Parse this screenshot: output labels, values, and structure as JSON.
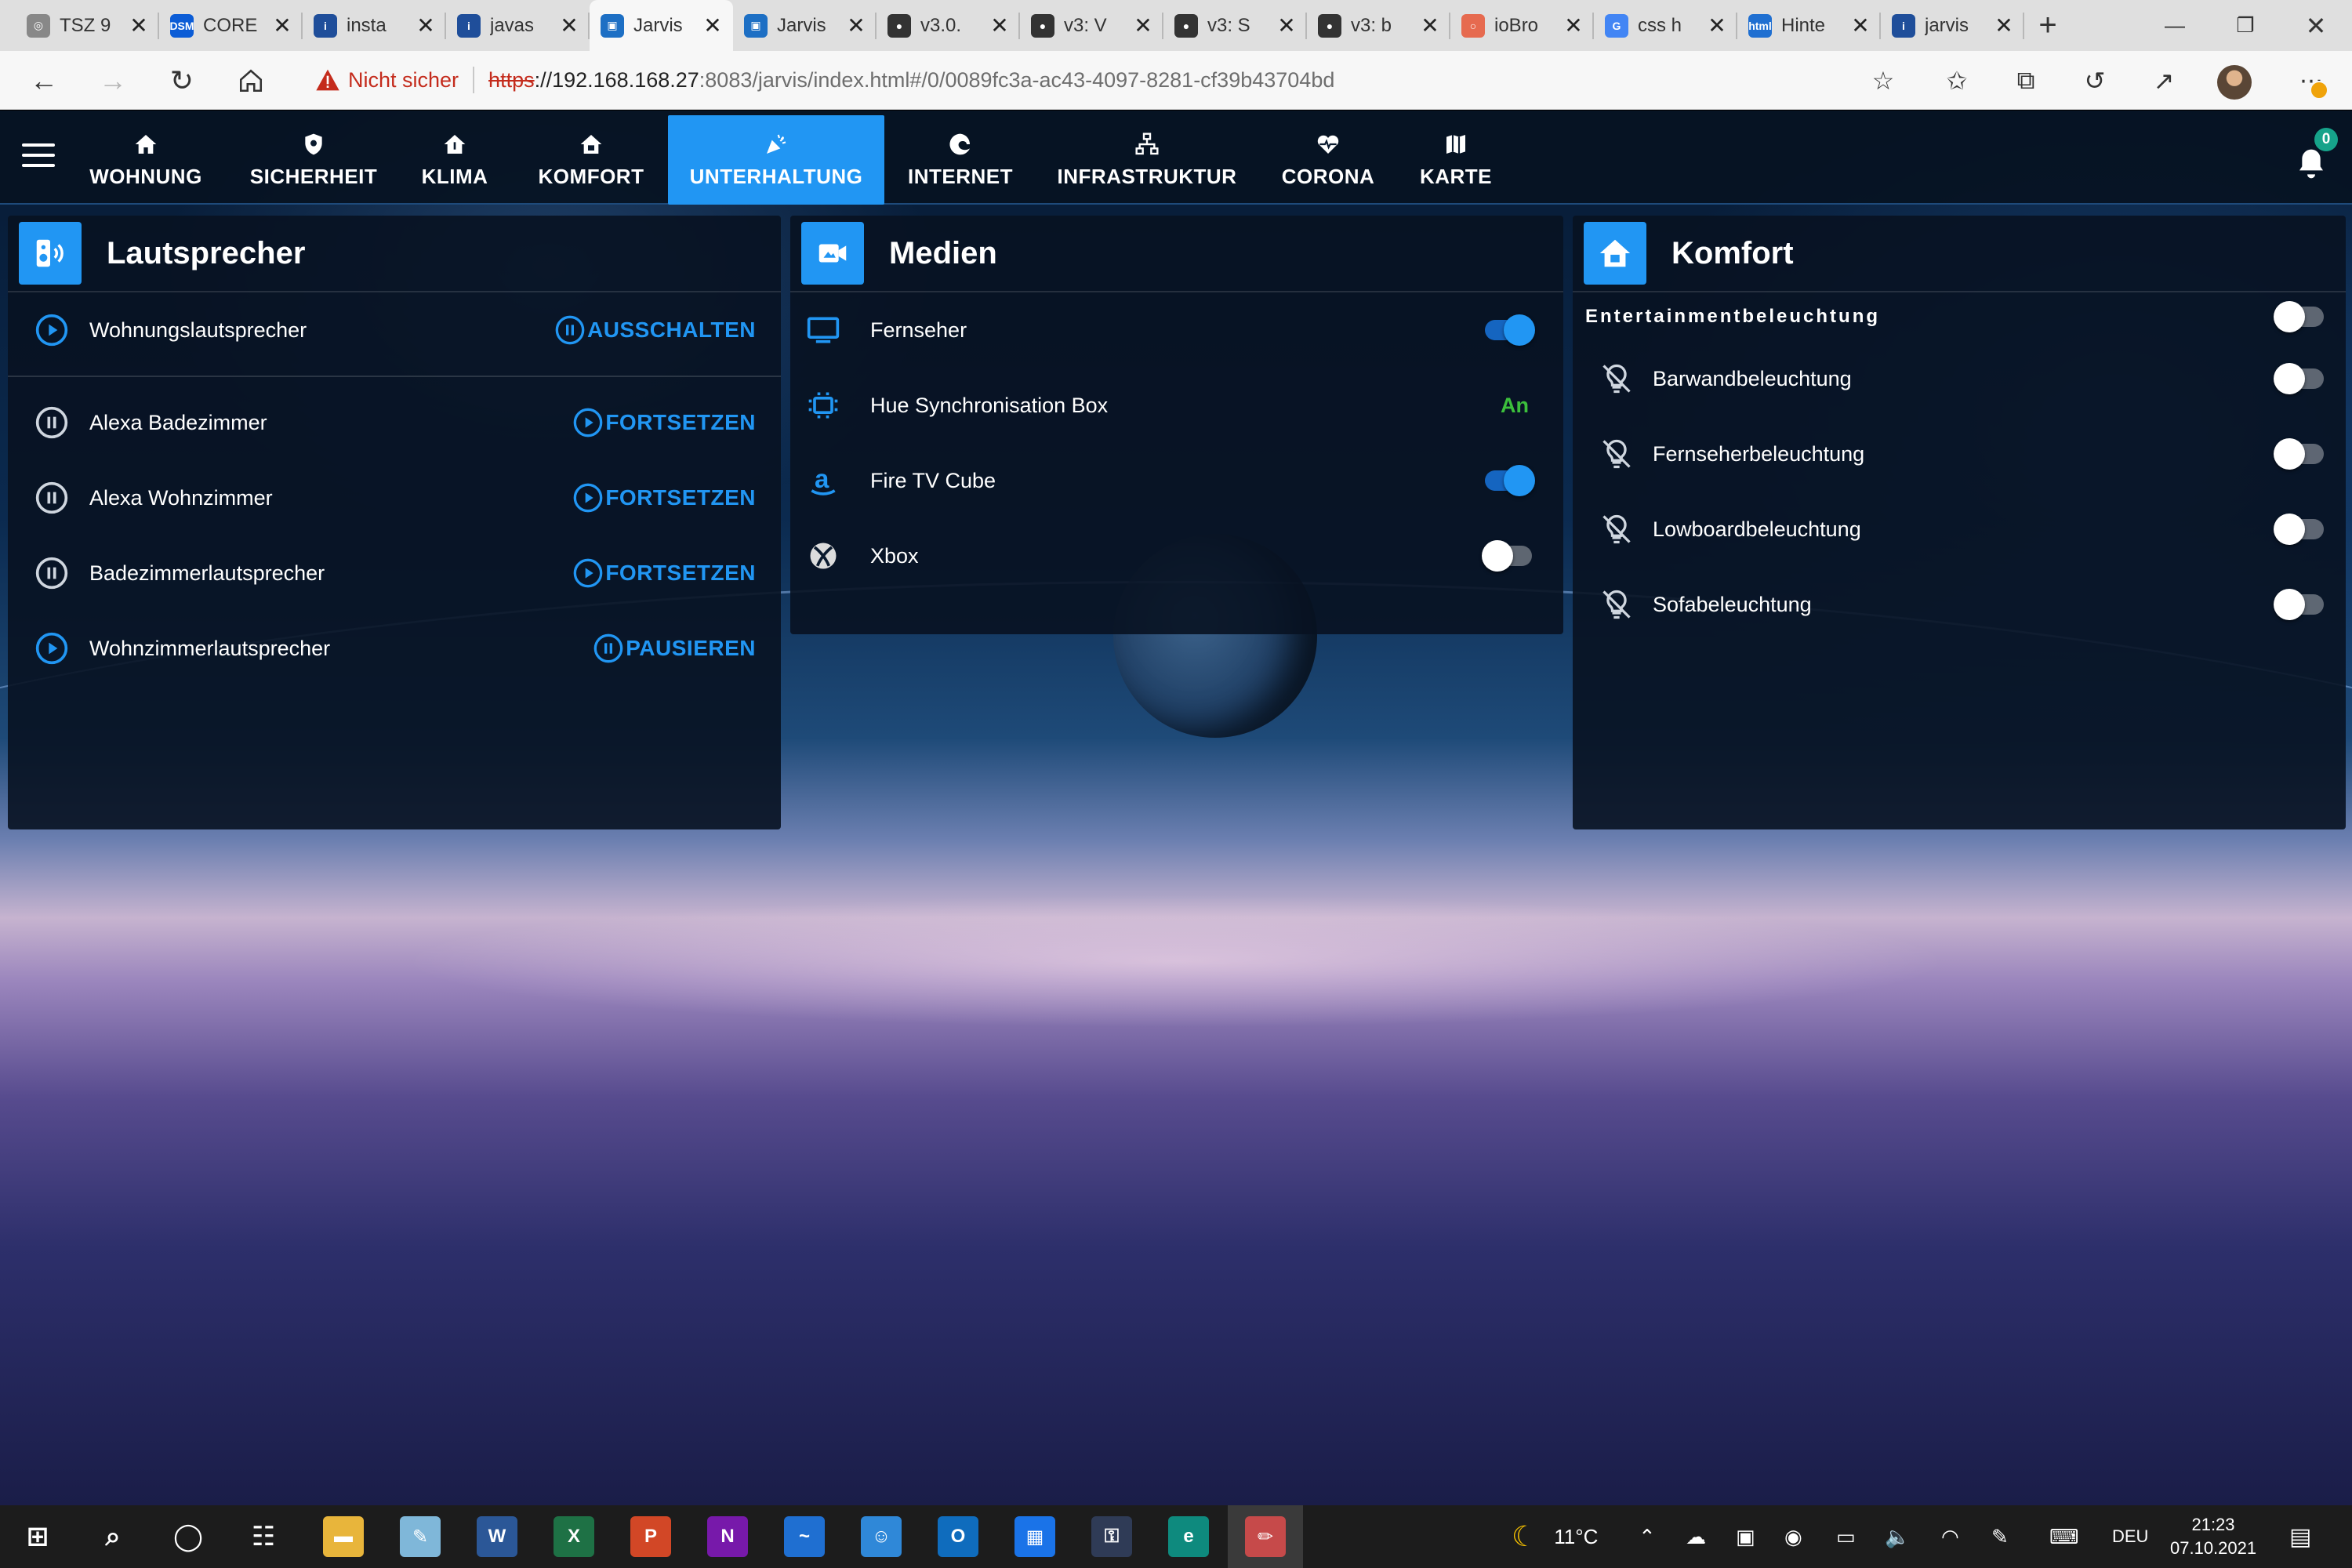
{
  "browser": {
    "tabs": [
      {
        "title": "TSZ 9",
        "favicon": "tsz",
        "favicon_color": "#888888",
        "active": false
      },
      {
        "title": "CORE",
        "favicon": "dsm",
        "favicon_color": "#0b5cd6",
        "active": false
      },
      {
        "title": "insta",
        "favicon": "info",
        "favicon_color": "#1f4e9a",
        "active": false
      },
      {
        "title": "javas",
        "favicon": "info",
        "favicon_color": "#1f4e9a",
        "active": false
      },
      {
        "title": "Jarvis",
        "favicon": "jarvis",
        "favicon_color": "#1d6fc4",
        "active": true
      },
      {
        "title": "Jarvis",
        "favicon": "jarvis",
        "favicon_color": "#1d6fc4",
        "active": false
      },
      {
        "title": "v3.0.",
        "favicon": "github",
        "favicon_color": "#333333",
        "active": false
      },
      {
        "title": "v3: V",
        "favicon": "github",
        "favicon_color": "#333333",
        "active": false
      },
      {
        "title": "v3: S",
        "favicon": "github",
        "favicon_color": "#333333",
        "active": false
      },
      {
        "title": "v3: b",
        "favicon": "github",
        "favicon_color": "#333333",
        "active": false
      },
      {
        "title": "ioBro",
        "favicon": "iobroker",
        "favicon_color": "#e66a4f",
        "active": false
      },
      {
        "title": "css h",
        "favicon": "google",
        "favicon_color": "#4285f4",
        "active": false
      },
      {
        "title": "Hinte",
        "favicon": "html",
        "favicon_color": "#1f6fd1",
        "active": false
      },
      {
        "title": "jarvis",
        "favicon": "info",
        "favicon_color": "#1f4e9a",
        "active": false
      }
    ],
    "security_label": "Nicht sicher",
    "url_scheme": "https",
    "url_host": "://192.168.168.27",
    "url_rest": ":8083/jarvis/index.html#/0/0089fc3a-ac43-4097-8281-cf39b43704bd"
  },
  "app": {
    "notifications_count": "0",
    "nav": [
      {
        "label": "WOHNUNG",
        "icon": "home-icon",
        "active": false
      },
      {
        "label": "SICHERHEIT",
        "icon": "shield-icon",
        "active": false
      },
      {
        "label": "KLIMA",
        "icon": "home-thermometer-icon",
        "active": false
      },
      {
        "label": "KOMFORT",
        "icon": "home-roof-icon",
        "active": false
      },
      {
        "label": "UNTERHALTUNG",
        "icon": "party-popper-icon",
        "active": true
      },
      {
        "label": "INTERNET",
        "icon": "edge-icon",
        "active": false
      },
      {
        "label": "INFRASTRUKTUR",
        "icon": "network-icon",
        "active": false
      },
      {
        "label": "CORONA",
        "icon": "heart-pulse-icon",
        "active": false
      },
      {
        "label": "KARTE",
        "icon": "map-icon",
        "active": false
      }
    ],
    "accent_color": "#2196f3",
    "cards": {
      "lautsprecher": {
        "title": "Lautsprecher",
        "rows": [
          {
            "label": "Wohnungslautsprecher",
            "state": "play",
            "action": "AUSSCHALTEN",
            "action_icon": "pause-circle-icon"
          },
          {
            "label": "Alexa Badezimmer",
            "state": "pause",
            "action": "FORTSETZEN",
            "action_icon": "play-circle-icon"
          },
          {
            "label": "Alexa Wohnzimmer",
            "state": "pause",
            "action": "FORTSETZEN",
            "action_icon": "play-circle-icon"
          },
          {
            "label": "Badezimmerlautsprecher",
            "state": "pause",
            "action": "FORTSETZEN",
            "action_icon": "play-circle-icon"
          },
          {
            "label": "Wohnzimmerlautsprecher",
            "state": "play",
            "action": "PAUSIEREN",
            "action_icon": "pause-circle-icon"
          }
        ]
      },
      "medien": {
        "title": "Medien",
        "rows": [
          {
            "label": "Fernseher",
            "icon": "monitor-icon",
            "toggle": true
          },
          {
            "label": "Hue Synchronisation Box",
            "icon": "hue-sync-box-icon",
            "status": "An"
          },
          {
            "label": "Fire TV Cube",
            "icon": "amazon-icon",
            "toggle": true
          },
          {
            "label": "Xbox",
            "icon": "xbox-icon",
            "toggle": false
          }
        ]
      },
      "komfort": {
        "title": "Komfort",
        "group_label": "Entertainmentbeleuchtung",
        "group_toggle": false,
        "rows": [
          {
            "label": "Barwandbeleuchtung",
            "icon": "lightbulb-off-icon",
            "toggle": false
          },
          {
            "label": "Fernseherbeleuchtung",
            "icon": "lightbulb-off-icon",
            "toggle": false
          },
          {
            "label": "Lowboardbeleuchtung",
            "icon": "lightbulb-off-icon",
            "toggle": false
          },
          {
            "label": "Sofabeleuchtung",
            "icon": "lightbulb-off-icon",
            "toggle": false
          }
        ]
      }
    }
  },
  "taskbar": {
    "apps": [
      "start-icon",
      "search-icon",
      "cortana-icon",
      "task-view-icon",
      "file-explorer-icon",
      "notes-icon",
      "word-icon",
      "excel-icon",
      "powerpoint-icon",
      "onenote-icon",
      "whiteboard-icon",
      "teams-icon",
      "outlook-icon",
      "calendar-icon",
      "keepass-icon",
      "edge-icon",
      "paint-icon"
    ],
    "weather_temp": "11°C",
    "language": "DEU",
    "time": "21:23",
    "date": "07.10.2021"
  }
}
